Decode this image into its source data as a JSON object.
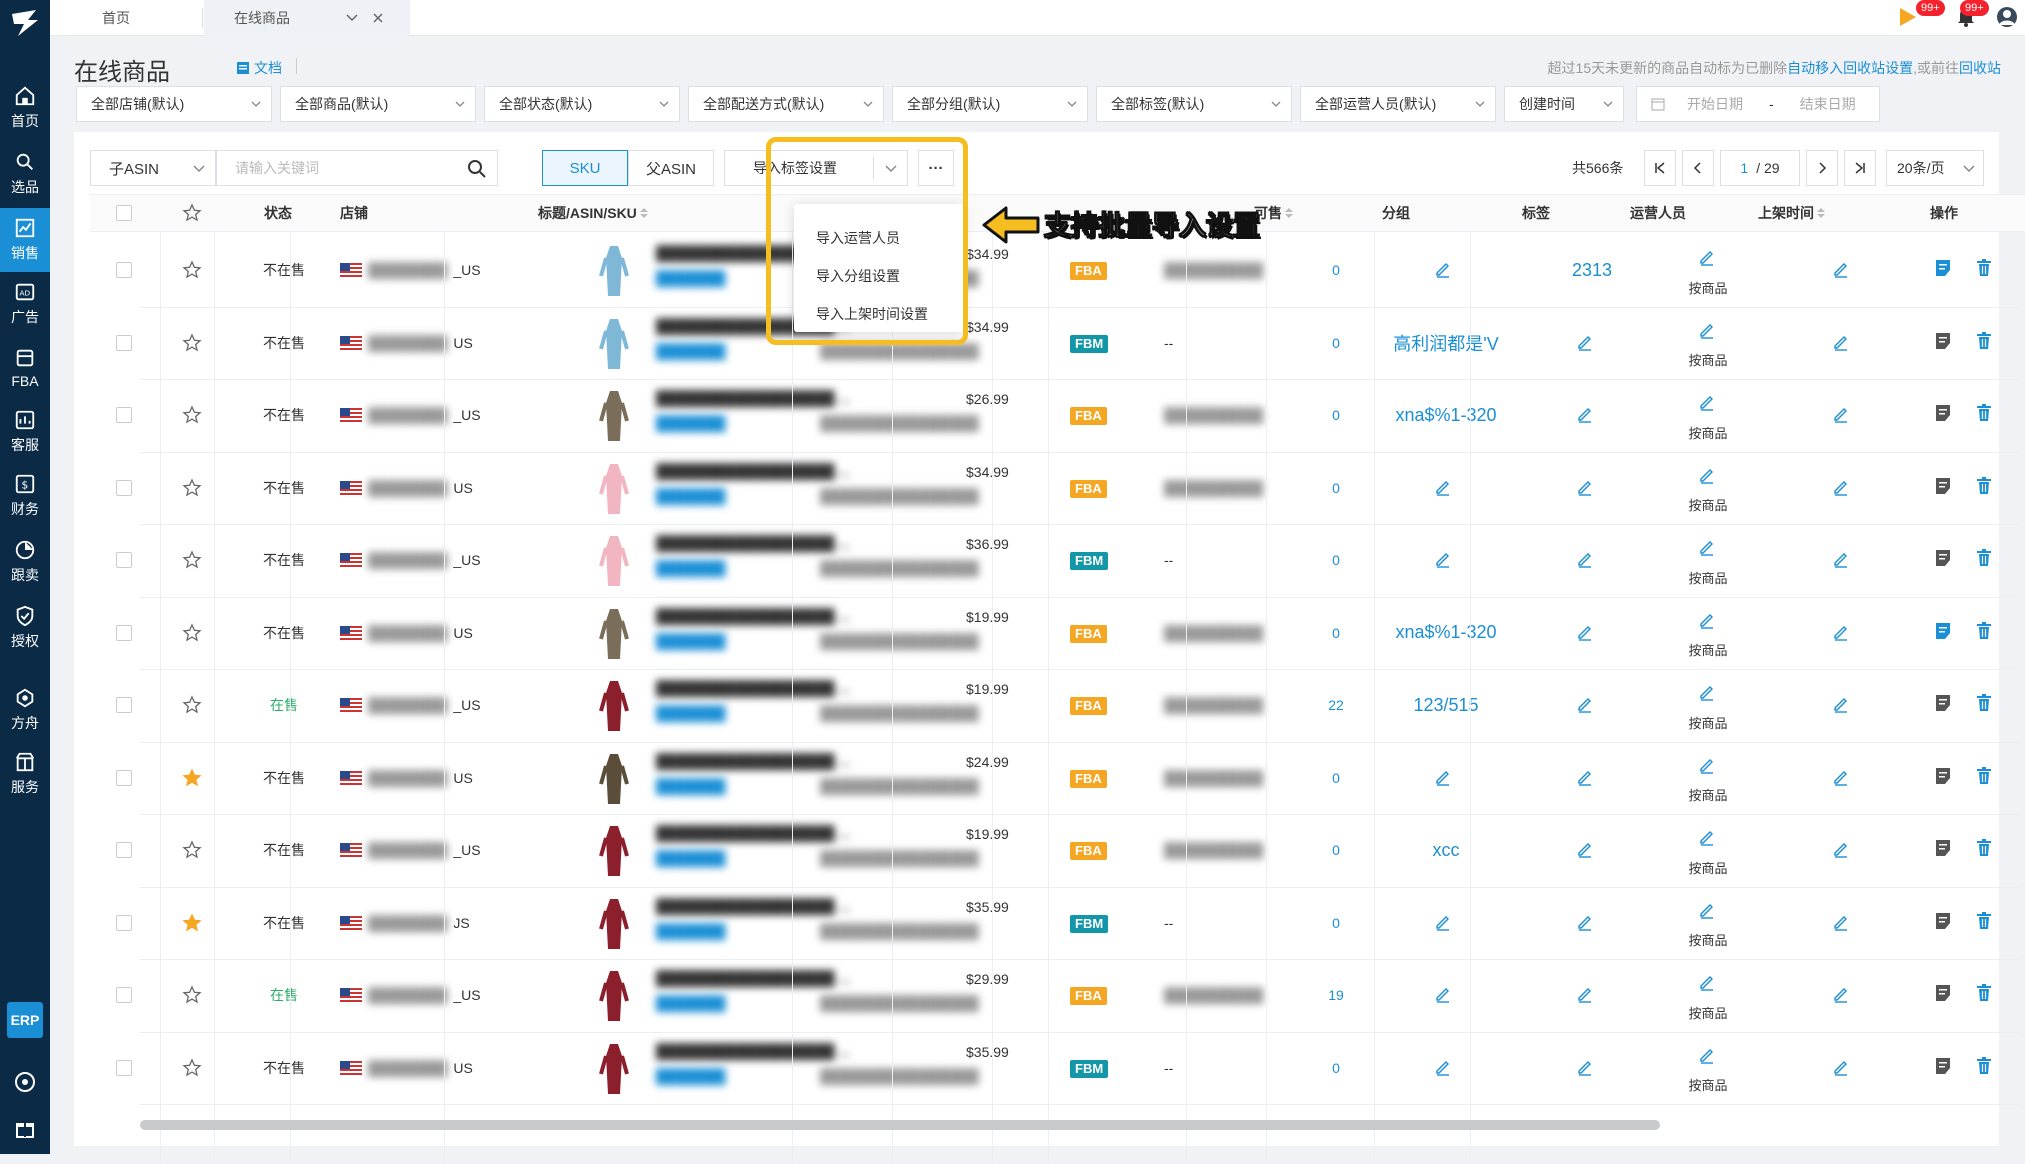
{
  "sidebar": {
    "items": [
      {
        "label": "首页",
        "icon": "home-icon"
      },
      {
        "label": "选品",
        "icon": "search-icon"
      },
      {
        "label": "销售",
        "icon": "chart-icon",
        "active": true
      },
      {
        "label": "广告",
        "icon": "ad-icon"
      },
      {
        "label": "FBA",
        "icon": "fba-icon"
      },
      {
        "label": "客服",
        "icon": "service-icon"
      },
      {
        "label": "财务",
        "icon": "finance-icon"
      },
      {
        "label": "跟卖",
        "icon": "follow-icon"
      },
      {
        "label": "授权",
        "icon": "shield-icon"
      },
      {
        "label": "方舟",
        "icon": "ark-icon"
      },
      {
        "label": "服务",
        "icon": "store-icon"
      }
    ],
    "erp": "ERP"
  },
  "topbar": {
    "tabs": [
      {
        "label": "首页"
      },
      {
        "label": "在线商品"
      }
    ],
    "badge1": "99+",
    "badge2": "99+"
  },
  "page": {
    "title": "在线商品",
    "doc": "文档",
    "hint_prefix": "超过15天未更新的商品自动标为已删除",
    "hint_link1": "自动移入回收站设置",
    "hint_mid": ",或前往",
    "hint_link2": "回收站"
  },
  "filters": {
    "shop": "全部店铺(默认)",
    "product": "全部商品(默认)",
    "status": "全部状态(默认)",
    "delivery": "全部配送方式(默认)",
    "group": "全部分组(默认)",
    "tag": "全部标签(默认)",
    "operator": "全部运营人员(默认)",
    "time_type": "创建时间",
    "start_date": "开始日期",
    "date_sep": "-",
    "end_date": "结束日期"
  },
  "toolbar": {
    "search_type": "子ASIN",
    "search_placeholder": "请输入关键词",
    "sku": "SKU",
    "parent_asin": "父ASIN",
    "import_btn": "导入标签设置",
    "more": "···",
    "total": "共566条",
    "page_current": "1",
    "page_total": "/ 29",
    "page_size": "20条/页"
  },
  "dropdown": {
    "items": [
      "导入运营人员",
      "导入分组设置",
      "导入上架时间设置"
    ]
  },
  "callout": "支持批量导入设置",
  "table": {
    "headers": {
      "status": "状态",
      "shop": "店铺",
      "title": "标题/ASIN/SKU",
      "available": "可售",
      "group": "分组",
      "tag": "标签",
      "operator": "运营人员",
      "list_time": "上架时间",
      "action": "操作"
    },
    "rows": [
      {
        "status": "不在售",
        "shop_suffix": "_US",
        "price": "$34.99",
        "ship": "FBA",
        "avail": "0",
        "group": "",
        "tag": "2313",
        "star": false,
        "op": "按商品"
      },
      {
        "status": "不在售",
        "shop_suffix": "US",
        "price": "$34.99",
        "ship": "FBM",
        "avail": "0",
        "group": "高利润都是'V",
        "tag": "",
        "star": false,
        "op": "按商品"
      },
      {
        "status": "不在售",
        "shop_suffix": "_US",
        "price": "$26.99",
        "ship": "FBA",
        "avail": "0",
        "group": "xna$%1-320",
        "tag": "",
        "star": false,
        "op": "按商品"
      },
      {
        "status": "不在售",
        "shop_suffix": "US",
        "price": "$34.99",
        "ship": "FBA",
        "avail": "0",
        "group": "",
        "tag": "",
        "star": false,
        "op": "按商品"
      },
      {
        "status": "不在售",
        "shop_suffix": "_US",
        "price": "$36.99",
        "ship": "FBM",
        "avail": "0",
        "group": "",
        "tag": "",
        "star": false,
        "op": "按商品"
      },
      {
        "status": "不在售",
        "shop_suffix": "US",
        "price": "$19.99",
        "ship": "FBA",
        "avail": "0",
        "group": "xna$%1-320",
        "tag": "",
        "star": false,
        "op": "按商品"
      },
      {
        "status": "在售",
        "shop_suffix": "_US",
        "price": "$19.99",
        "ship": "FBA",
        "avail": "22",
        "group": "123/515",
        "tag": "",
        "star": false,
        "op": "按商品"
      },
      {
        "status": "不在售",
        "shop_suffix": "US",
        "price": "$24.99",
        "ship": "FBA",
        "avail": "0",
        "group": "",
        "tag": "",
        "star": true,
        "op": "按商品"
      },
      {
        "status": "不在售",
        "shop_suffix": "_US",
        "price": "$19.99",
        "ship": "FBA",
        "avail": "0",
        "group": "xcc",
        "tag": "",
        "star": false,
        "op": "按商品"
      },
      {
        "status": "不在售",
        "shop_suffix": "JS",
        "price": "$35.99",
        "ship": "FBM",
        "avail": "0",
        "group": "",
        "tag": "",
        "star": true,
        "op": "按商品"
      },
      {
        "status": "在售",
        "shop_suffix": "_US",
        "price": "$29.99",
        "ship": "FBA",
        "avail": "19",
        "group": "",
        "tag": "",
        "star": false,
        "op": "按商品"
      },
      {
        "status": "不在售",
        "shop_suffix": "US",
        "price": "$35.99",
        "ship": "FBM",
        "avail": "0",
        "group": "",
        "tag": "",
        "star": false,
        "op": "按商品"
      }
    ]
  },
  "colors": {
    "primary": "#1b8fd6",
    "sidebar": "#0a2a46",
    "fba": "#f5a623",
    "fbm": "#1296a8",
    "highlight": "#f5bd1f"
  }
}
